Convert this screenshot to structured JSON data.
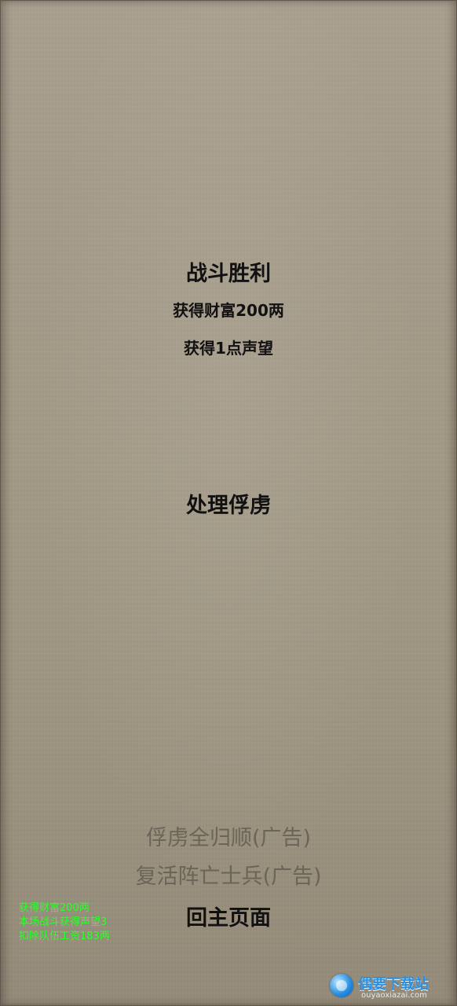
{
  "result": {
    "title": "战斗胜利",
    "rewards": [
      "获得财富200两",
      "获得1点声望"
    ]
  },
  "actions": {
    "handle_prisoners": "处理俘虏",
    "prisoners_surrender_ad": "俘虏全归顺(广告)",
    "revive_soldiers_ad": "复活阵亡士兵(广告)",
    "return_home": "回主页面"
  },
  "battle_log": [
    "获得财富200两",
    "本场战斗获得声望3",
    "扣除队伍工资183两"
  ],
  "watermark": {
    "name": "偶要下载站",
    "url": "ouyaoxiazai.com"
  },
  "colors": {
    "log_text": "#2bff2b",
    "primary_text": "#111111",
    "disabled_text": "#6b6458",
    "background": "#a39986"
  }
}
